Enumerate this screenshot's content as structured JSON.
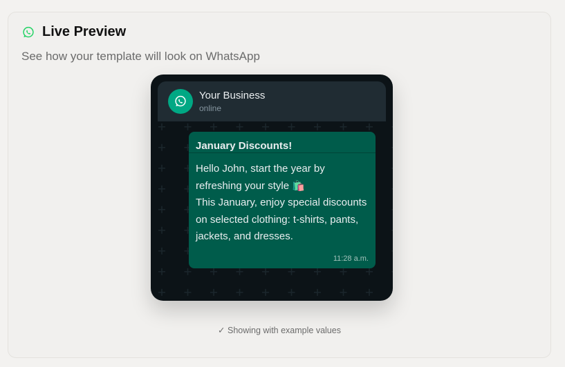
{
  "header": {
    "icon": "whatsapp-icon",
    "title": "Live Preview",
    "subtitle": "See how your template will look on WhatsApp"
  },
  "preview": {
    "business_name": "Your Business",
    "status": "online",
    "avatar_icon": "whatsapp-icon",
    "message": {
      "header": "January Discounts!",
      "body_line1": "Hello John, start the year by refreshing your style 🛍️",
      "body_line2": "This January, enjoy special discounts on selected clothing: t-shirts, pants, jackets, and dresses.",
      "time": "11:28 a.m."
    }
  },
  "footer_note": "✓ Showing with example values",
  "colors": {
    "accent_green": "#25d366",
    "bubble_green": "#005c4b",
    "chat_bg": "#0c1317",
    "header_bg": "#202c33"
  }
}
